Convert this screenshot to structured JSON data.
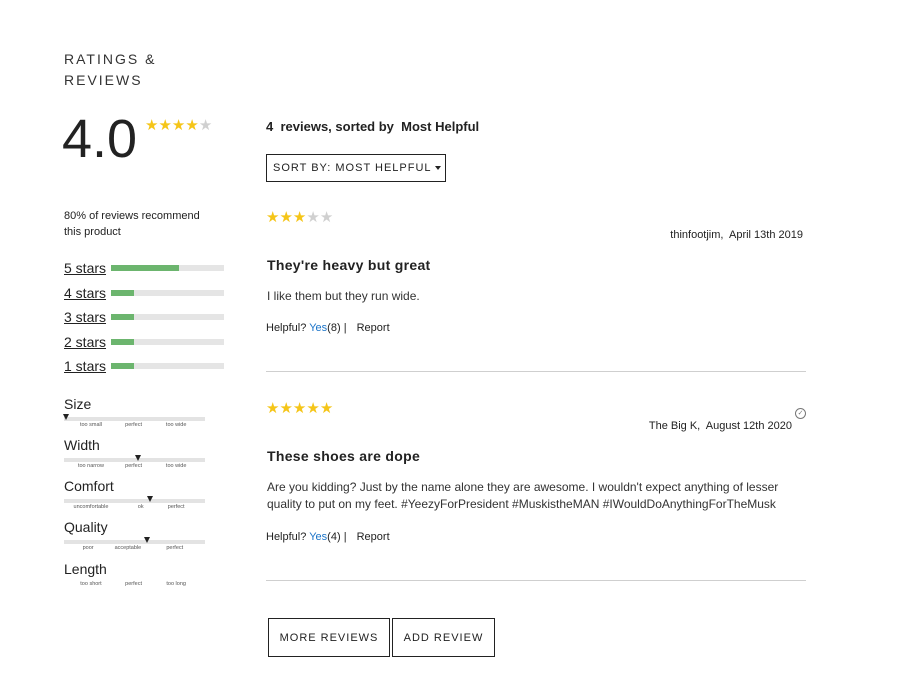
{
  "header": {
    "title": "RATINGS & REVIEWS"
  },
  "summary": {
    "average": "4.0",
    "stars": 4,
    "recommend_text": "80% of reviews recommend this product"
  },
  "distribution": [
    {
      "label": "5 stars",
      "fraction": 0.6
    },
    {
      "label": "4 stars",
      "fraction": 0.2
    },
    {
      "label": "3 stars",
      "fraction": 0.2
    },
    {
      "label": "2 stars",
      "fraction": 0.2
    },
    {
      "label": "1 stars",
      "fraction": 0.2
    }
  ],
  "characteristics": [
    {
      "name": "Size",
      "value": 0.02,
      "labels": [
        "too small",
        "perfect",
        "too wide"
      ]
    },
    {
      "name": "Width",
      "value": 0.53,
      "labels": [
        "too narrow",
        "perfect",
        "too wide"
      ]
    },
    {
      "name": "Comfort",
      "value": 0.61,
      "labels": [
        "uncomfortable",
        "ok",
        "perfect"
      ]
    },
    {
      "name": "Quality",
      "value": 0.59,
      "labels": [
        "poor",
        "acceptable",
        "perfect"
      ]
    },
    {
      "name": "Length",
      "value": null,
      "labels": [
        "too short",
        "perfect",
        "too long"
      ]
    }
  ],
  "list_header": {
    "count": "4",
    "sorted_text": "reviews, sorted by",
    "sort_value": "Most Helpful"
  },
  "sort_button": {
    "label": "SORT BY: MOST HELPFUL"
  },
  "reviews": [
    {
      "rating": 3,
      "author": "thinfootjim,",
      "date": "April 13th 2019",
      "verified": false,
      "title": "They're heavy but great",
      "body": "I like them but they run wide.",
      "helpful_label": "Helpful?",
      "yes_label": "Yes",
      "yes_count": "(8)",
      "separator": "|",
      "report_label": "Report"
    },
    {
      "rating": 5,
      "author": "The Big K,",
      "date": "August 12th 2020",
      "verified": true,
      "title": "These shoes are dope",
      "body": "Are you kidding? Just by the name alone they are awesome. I wouldn't expect anything of lesser quality to put on my feet. #YeezyForPresident #MuskistheMAN #IWouldDoAnythingForTheMusk",
      "helpful_label": "Helpful?",
      "yes_label": "Yes",
      "yes_count": "(4)",
      "separator": "|",
      "report_label": "Report"
    }
  ],
  "buttons": {
    "more_reviews": "MORE REVIEWS",
    "add_review": "ADD REVIEW"
  },
  "colors": {
    "star": "#f5c518",
    "bar_fill": "#6cb56e",
    "link": "#1a73c8"
  }
}
